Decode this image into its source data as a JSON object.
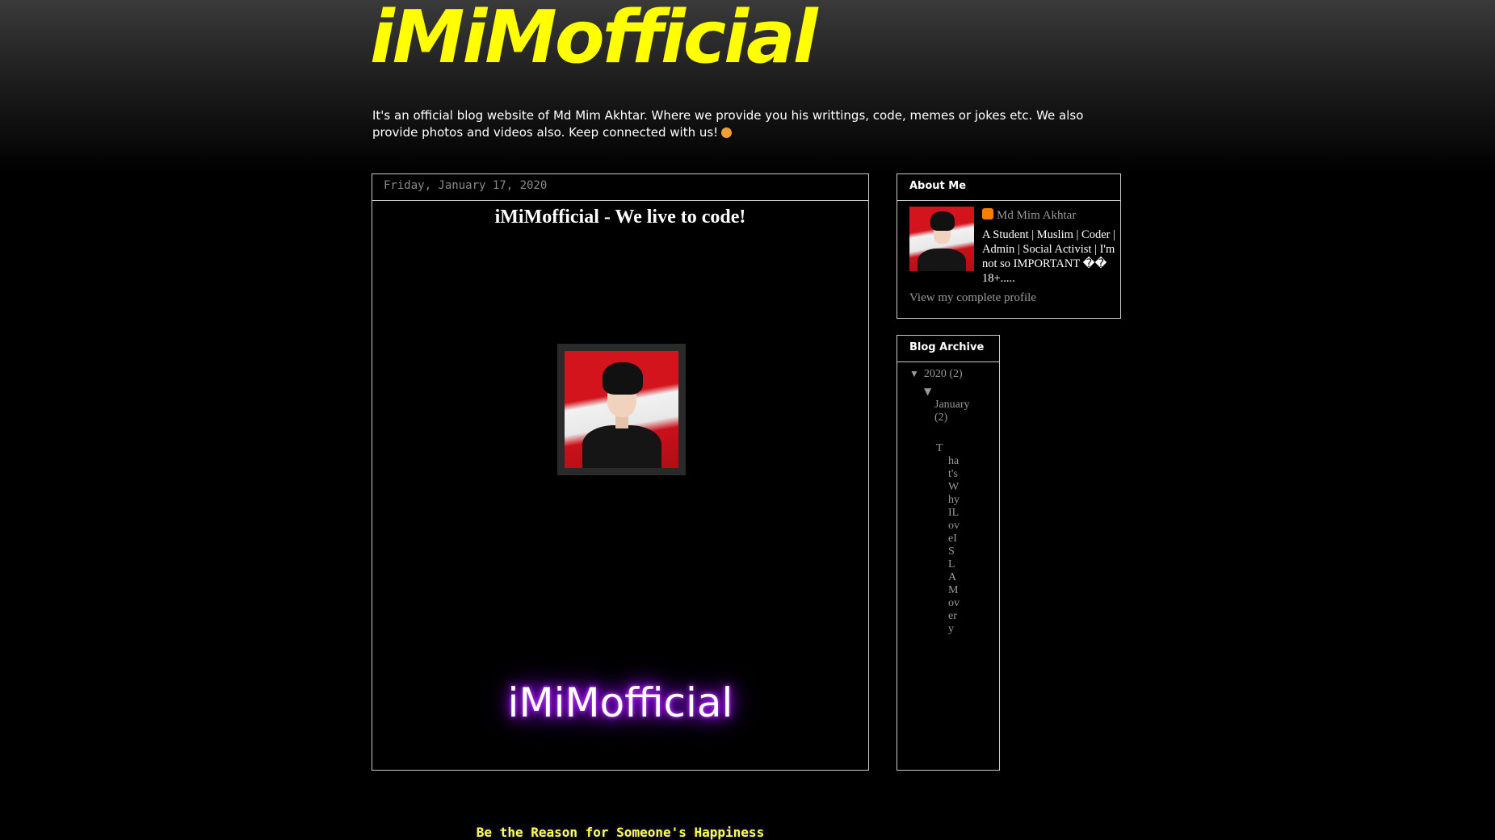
{
  "header": {
    "title": "iMiMofficial",
    "description": "It's an official blog website of Md Mim Akhtar. Where we provide you his writtings, code, memes or jokes etc. We also provide photos and videos also. Keep connected with us!"
  },
  "post": {
    "date": "Friday, January 17, 2020",
    "title": "iMiMofficial - We live to code!",
    "neon_text": "iMiMofficial",
    "tagline": "Be the Reason for Someone's Happiness"
  },
  "about": {
    "widget_title": "About Me",
    "name": "Md Mim Akhtar",
    "bio": "A Student | Muslim | Coder | Admin | Social Activist | I'm not so IMPORTANT �� 18+.....",
    "view_profile": "View my complete profile"
  },
  "archive": {
    "widget_title": "Blog Archive",
    "year": "2020",
    "year_count": "(2)",
    "month": "January",
    "month_count": "(2)",
    "post_first_letter": "T",
    "post_rest": "hat'sWhyILoveISLAMovery"
  },
  "colors": {
    "title": "#ffff00",
    "neon_glow": "#9b00ff",
    "tagline": "#ffff44",
    "link": "#999999",
    "border": "#cccccc"
  },
  "icons": {
    "toggle": "triangle-down",
    "blogger": "blogger-icon",
    "emoji": "kiss-emoji"
  }
}
